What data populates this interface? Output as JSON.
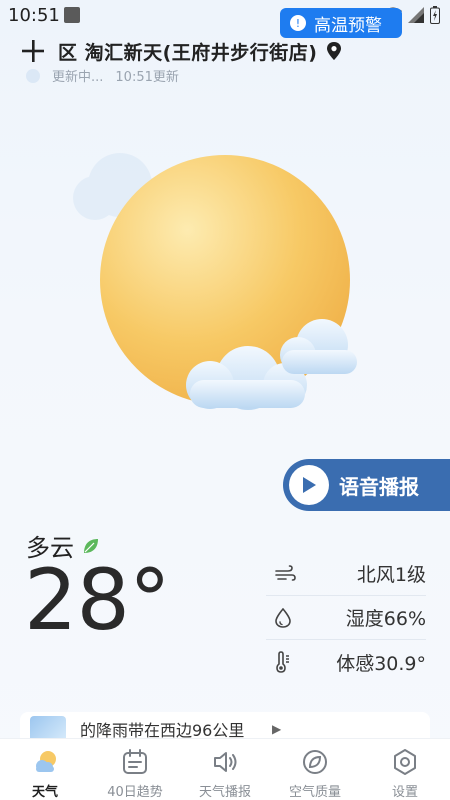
{
  "status_bar": {
    "time": "10:51"
  },
  "header": {
    "location": "区 淘汇新天(王府井步行街店)",
    "updating": "更新中...",
    "updated_time": "10:51更新"
  },
  "voice": {
    "label": "语音播报"
  },
  "weather": {
    "condition": "多云",
    "temperature": "28°",
    "details": [
      {
        "icon": "wind-icon",
        "value": "北风1级"
      },
      {
        "icon": "humidity-icon",
        "value": "湿度66%"
      },
      {
        "icon": "thermometer-icon",
        "value": "体感30.9°"
      }
    ]
  },
  "alert": {
    "text": "的降雨带在西边96公里",
    "badge": "高温预警"
  },
  "nav": [
    {
      "icon": "weather-icon",
      "label": "天气",
      "active": true
    },
    {
      "icon": "calendar-icon",
      "label": "40日趋势",
      "active": false
    },
    {
      "icon": "speaker-icon",
      "label": "天气播报",
      "active": false
    },
    {
      "icon": "leaf-icon",
      "label": "空气质量",
      "active": false
    },
    {
      "icon": "gear-icon",
      "label": "设置",
      "active": false
    }
  ],
  "colors": {
    "accent": "#3a6db0",
    "alert_blue": "#1e7cf0",
    "sun": "#f5c055"
  }
}
